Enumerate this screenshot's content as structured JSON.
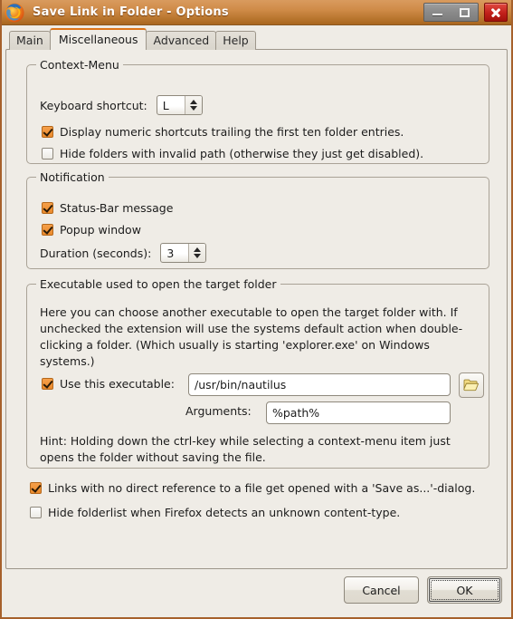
{
  "window": {
    "title": "Save Link in Folder - Options",
    "app_icon": "firefox-icon",
    "minimize_label": "Minimize",
    "maximize_label": "Maximize",
    "close_label": "Close"
  },
  "tabs": [
    {
      "label": "Main",
      "selected": false
    },
    {
      "label": "Miscellaneous",
      "selected": true
    },
    {
      "label": "Advanced",
      "selected": false
    },
    {
      "label": "Help",
      "selected": false
    }
  ],
  "groups": {
    "context_menu": {
      "title": "Context-Menu",
      "keyboard_shortcut_label": "Keyboard shortcut:",
      "keyboard_shortcut_value": "L",
      "numeric_shortcuts": {
        "label": "Display numeric shortcuts trailing the first ten folder entries.",
        "checked": true
      },
      "hide_invalid": {
        "label": "Hide folders with invalid path (otherwise they just get disabled).",
        "checked": false
      }
    },
    "notification": {
      "title": "Notification",
      "statusbar": {
        "label": "Status-Bar message",
        "checked": true
      },
      "popup": {
        "label": "Popup window",
        "checked": true
      },
      "duration_label": "Duration (seconds):",
      "duration_value": "3"
    },
    "executable": {
      "title": "Executable used to open the target folder",
      "description": "Here you can choose another executable to open the target folder with. If unchecked the extension will use the systems default action when double-clicking a folder. (Which usually is starting 'explorer.exe' on Windows systems.)",
      "use_executable": {
        "label": "Use this executable:",
        "checked": true
      },
      "executable_path": "/usr/bin/nautilus",
      "browse_icon": "folder-open-icon",
      "arguments_label": "Arguments:",
      "arguments_value": "%path%",
      "hint": "Hint: Holding down the ctrl-key while selecting a context-menu item just opens the folder without saving the file."
    }
  },
  "bottom_options": {
    "save_as_dialog": {
      "label": "Links with no direct reference to a file get opened with a 'Save as...'-dialog.",
      "checked": true
    },
    "hide_folderlist": {
      "label": "Hide folderlist when Firefox detects an unknown content-type.",
      "checked": false
    }
  },
  "dialog_buttons": {
    "cancel": "Cancel",
    "ok": "OK"
  },
  "colors": {
    "titlebar_accent": "#c8843f",
    "tab_selected_accent": "#dd7418",
    "checkbox_checked": "#ea8a2c",
    "close_button": "#c1201a",
    "window_bg": "#efece6"
  }
}
